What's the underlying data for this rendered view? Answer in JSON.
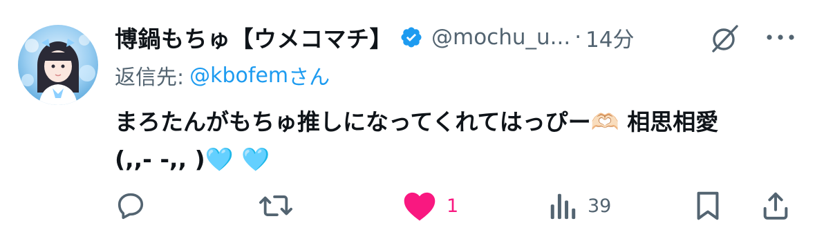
{
  "tweet": {
    "display_name": "博鍋もちゅ【ウメコマチ】",
    "handle": "@mochu_u...",
    "separator": "·",
    "time": "14分",
    "reply_prefix": "返信先:",
    "reply_target": "@kbofem",
    "reply_suffix": "さん",
    "text": "まろたんがもちゅ推しになってくれてはっぴー🫶🏻 相思相愛\n(,,- -,, )🩵 🩵"
  },
  "actions": {
    "reply_count": "",
    "retweet_count": "",
    "like_count": "1",
    "view_count": "39",
    "liked": true
  },
  "icons": {
    "verified": "verified-badge-icon",
    "grok": "grok-icon",
    "more": "more-dots-icon",
    "reply": "reply-icon",
    "retweet": "retweet-icon",
    "like": "heart-icon",
    "views": "views-bars-icon",
    "bookmark": "bookmark-icon",
    "share": "share-icon"
  },
  "colors": {
    "text": "#0f1419",
    "secondary": "#536471",
    "link": "#1d9bf0",
    "like": "#f91880",
    "verified": "#1d9bf0"
  }
}
